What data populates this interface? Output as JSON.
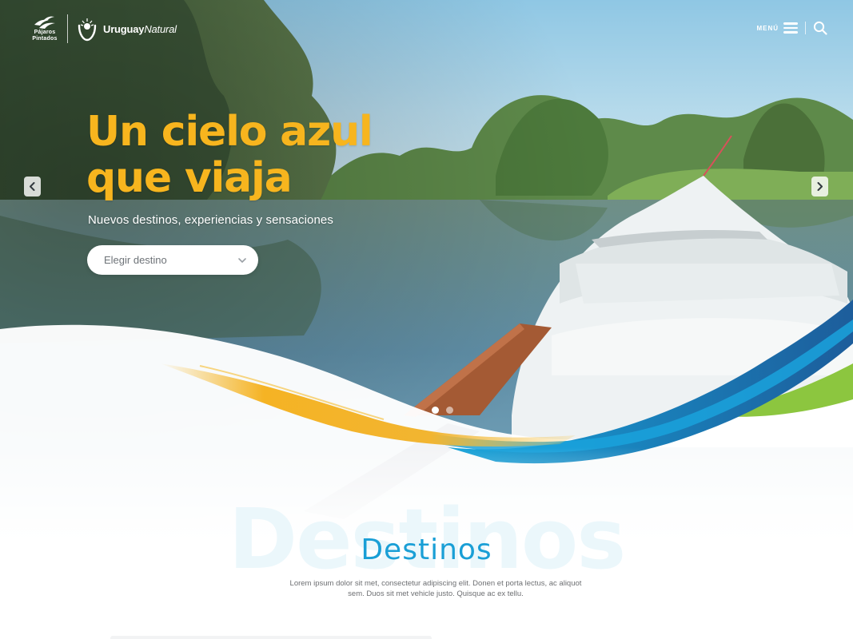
{
  "header": {
    "brand_birds_line1": "Pájaros",
    "brand_birds_line2": "Pintados",
    "brand_uy_bold": "Uruguay",
    "brand_uy_italic": "Natural",
    "menu_label": "MENÚ",
    "menu_icon": "hamburger-icon",
    "search_icon": "search-icon"
  },
  "hero": {
    "title_line1": "Un cielo azul",
    "title_line2": "que viaja",
    "subtitle": "Nuevos destinos, experiencias y sensaciones",
    "select_placeholder": "Elegir destino",
    "prev_icon": "chevron-left-icon",
    "next_icon": "chevron-right-icon",
    "slides": 2,
    "active_slide": 1
  },
  "destinos": {
    "bg_word": "Destinos",
    "title": "Destinos",
    "text_line1": "Lorem ipsum dolor sit met, consectetur adipiscing elit. Donen et porta lectus, ac aliquot",
    "text_line2": "sem. Duos sit met vehicle justo. Quisque ac ex tellu."
  },
  "colors": {
    "accent_yellow": "#f7b51e",
    "accent_blue": "#1a9fd6",
    "wave_green": "#8cc63f",
    "wave_navy": "#1d5d9b"
  }
}
